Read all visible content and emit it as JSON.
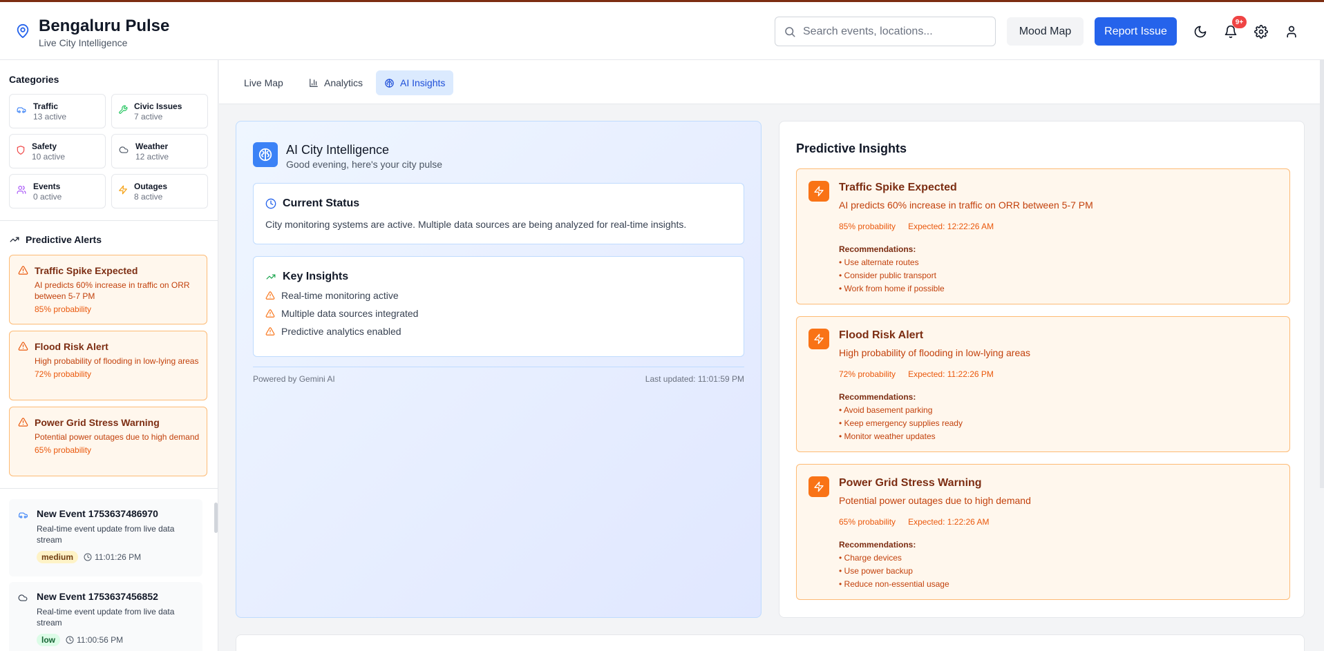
{
  "header": {
    "title": "Bengaluru Pulse",
    "subtitle": "Live City Intelligence",
    "search_placeholder": "Search events, locations...",
    "mood_map_label": "Mood Map",
    "report_issue_label": "Report Issue",
    "notification_badge": "9+"
  },
  "sidebar": {
    "categories_title": "Categories",
    "categories": [
      {
        "name": "Traffic",
        "count": "13 active",
        "icon": "car-icon",
        "color": "#3b82f6"
      },
      {
        "name": "Civic Issues",
        "count": "7 active",
        "icon": "wrench-icon",
        "color": "#22c55e"
      },
      {
        "name": "Safety",
        "count": "10 active",
        "icon": "shield-icon",
        "color": "#ef4444"
      },
      {
        "name": "Weather",
        "count": "12 active",
        "icon": "cloud-icon",
        "color": "#4b5563"
      },
      {
        "name": "Events",
        "count": "0 active",
        "icon": "users-icon",
        "color": "#a855f7"
      },
      {
        "name": "Outages",
        "count": "8 active",
        "icon": "zap-icon",
        "color": "#f59e0b"
      }
    ],
    "predictive_alerts_title": "Predictive Alerts",
    "alerts": [
      {
        "title": "Traffic Spike Expected",
        "description": "AI predicts 60% increase in traffic on ORR between 5-7 PM",
        "probability": "85% probability"
      },
      {
        "title": "Flood Risk Alert",
        "description": "High probability of flooding in low-lying areas",
        "probability": "72% probability"
      },
      {
        "title": "Power Grid Stress Warning",
        "description": "Potential power outages due to high demand",
        "probability": "65% probability"
      }
    ],
    "events": [
      {
        "title": "New Event 1753637486970",
        "description": "Real-time event update from live data stream",
        "severity": "medium",
        "time": "11:01:26 PM",
        "icon": "car-icon"
      },
      {
        "title": "New Event 1753637456852",
        "description": "Real-time event update from live data stream",
        "severity": "low",
        "time": "11:00:56 PM",
        "icon": "cloud-icon"
      }
    ]
  },
  "tabs": [
    {
      "label": "Live Map",
      "active": false
    },
    {
      "label": "Analytics",
      "active": false
    },
    {
      "label": "AI Insights",
      "active": true
    }
  ],
  "ai_panel": {
    "title": "AI City Intelligence",
    "subtitle": "Good evening, here's your city pulse",
    "status_title": "Current Status",
    "status_text": "City monitoring systems are active. Multiple data sources are being analyzed for real-time insights.",
    "insights_title": "Key Insights",
    "insights": [
      "Real-time monitoring active",
      "Multiple data sources integrated",
      "Predictive analytics enabled"
    ],
    "powered_by": "Powered by Gemini AI",
    "last_updated": "Last updated: 11:01:59 PM"
  },
  "predictive_insights": {
    "title": "Predictive Insights",
    "recommendations_label": "Recommendations:",
    "cards": [
      {
        "title": "Traffic Spike Expected",
        "description": "AI predicts 60% increase in traffic on ORR between 5-7 PM",
        "probability": "85% probability",
        "expected": "Expected: 12:22:26 AM",
        "recommendations": [
          "• Use alternate routes",
          "• Consider public transport",
          "• Work from home if possible"
        ]
      },
      {
        "title": "Flood Risk Alert",
        "description": "High probability of flooding in low-lying areas",
        "probability": "72% probability",
        "expected": "Expected: 11:22:26 PM",
        "recommendations": [
          "• Avoid basement parking",
          "• Keep emergency supplies ready",
          "• Monitor weather updates"
        ]
      },
      {
        "title": "Power Grid Stress Warning",
        "description": "Potential power outages due to high demand",
        "probability": "65% probability",
        "expected": "Expected: 1:22:26 AM",
        "recommendations": [
          "• Charge devices",
          "• Use power backup",
          "• Reduce non-essential usage"
        ]
      }
    ]
  },
  "colors": {
    "accent": "#2563eb",
    "alert_bg": "#fff7ed",
    "alert_border": "#fdba74"
  }
}
